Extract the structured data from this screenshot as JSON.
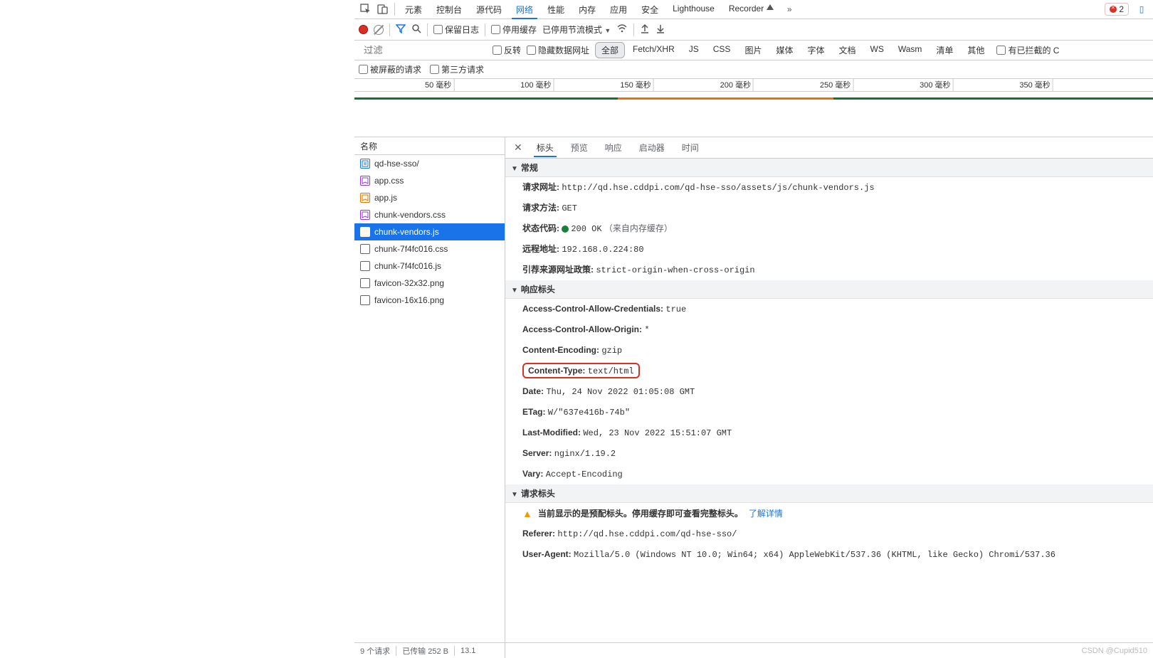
{
  "toolbar": {
    "tabs": [
      "元素",
      "控制台",
      "源代码",
      "网络",
      "性能",
      "内存",
      "应用",
      "安全",
      "Lighthouse",
      "Recorder"
    ],
    "active_tab": "网络",
    "more_glyph": "»",
    "error_count": "2"
  },
  "toolbar2": {
    "preserve_log": "保留日志",
    "disable_cache": "停用缓存",
    "throttle": "已停用节流模式"
  },
  "filter": {
    "placeholder": "过滤",
    "invert": "反转",
    "hide_data_urls": "隐藏数据网址",
    "types": [
      "全部",
      "Fetch/XHR",
      "JS",
      "CSS",
      "图片",
      "媒体",
      "字体",
      "文档",
      "WS",
      "Wasm",
      "清单",
      "其他"
    ],
    "active_type": "全部",
    "blocked_cookies": "有已拦截的 C",
    "blocked_requests": "被屏蔽的请求",
    "third_party": "第三方请求"
  },
  "timeline": {
    "ticks": [
      "50 毫秒",
      "100 毫秒",
      "150 毫秒",
      "200 毫秒",
      "250 毫秒",
      "300 毫秒",
      "350 毫秒"
    ]
  },
  "reqlist": {
    "header": "名称",
    "items": [
      {
        "name": "qd-hse-sso/",
        "icon": "doc"
      },
      {
        "name": "app.css",
        "icon": "css"
      },
      {
        "name": "app.js",
        "icon": "js"
      },
      {
        "name": "chunk-vendors.css",
        "icon": "css"
      },
      {
        "name": "chunk-vendors.js",
        "icon": "js",
        "selected": true
      },
      {
        "name": "chunk-7f4fc016.css",
        "icon": "other"
      },
      {
        "name": "chunk-7f4fc016.js",
        "icon": "other"
      },
      {
        "name": "favicon-32x32.png",
        "icon": "other"
      },
      {
        "name": "favicon-16x16.png",
        "icon": "other"
      }
    ]
  },
  "detail": {
    "tabs": [
      "标头",
      "预览",
      "响应",
      "启动器",
      "时间"
    ],
    "active_tab": "标头",
    "sections": {
      "general": {
        "title": "常规",
        "url_label": "请求网址:",
        "url": "http://qd.hse.cddpi.com/qd-hse-sso/assets/js/chunk-vendors.js",
        "method_label": "请求方法:",
        "method": "GET",
        "status_label": "状态代码:",
        "status": "200 OK",
        "status_note": "（来自内存缓存）",
        "remote_label": "远程地址:",
        "remote": "192.168.0.224:80",
        "referrer_label": "引荐来源网址政策:",
        "referrer": "strict-origin-when-cross-origin"
      },
      "response": {
        "title": "响应标头",
        "rows": [
          {
            "k": "Access-Control-Allow-Credentials:",
            "v": "true"
          },
          {
            "k": "Access-Control-Allow-Origin:",
            "v": "*"
          },
          {
            "k": "Content-Encoding:",
            "v": "gzip"
          },
          {
            "k": "Content-Type:",
            "v": "text/html",
            "hl": true
          },
          {
            "k": "Date:",
            "v": "Thu, 24 Nov 2022 01:05:08 GMT"
          },
          {
            "k": "ETag:",
            "v": "W/\"637e416b-74b\""
          },
          {
            "k": "Last-Modified:",
            "v": "Wed, 23 Nov 2022 15:51:07 GMT"
          },
          {
            "k": "Server:",
            "v": "nginx/1.19.2"
          },
          {
            "k": "Vary:",
            "v": "Accept-Encoding"
          }
        ]
      },
      "request": {
        "title": "请求标头",
        "warn": "当前显示的是预配标头。停用缓存即可查看完整标头。",
        "warn_link": "了解详情",
        "rows": [
          {
            "k": "Referer:",
            "v": "http://qd.hse.cddpi.com/qd-hse-sso/"
          },
          {
            "k": "User-Agent:",
            "v": "Mozilla/5.0 (Windows NT 10.0; Win64; x64) AppleWebKit/537.36 (KHTML, like Gecko) Chromi/537.36"
          }
        ]
      }
    }
  },
  "status": {
    "requests": "9 个请求",
    "transferred": "已传输 252 B",
    "resources": "13.1",
    "watermark": "CSDN @Cupid510"
  }
}
